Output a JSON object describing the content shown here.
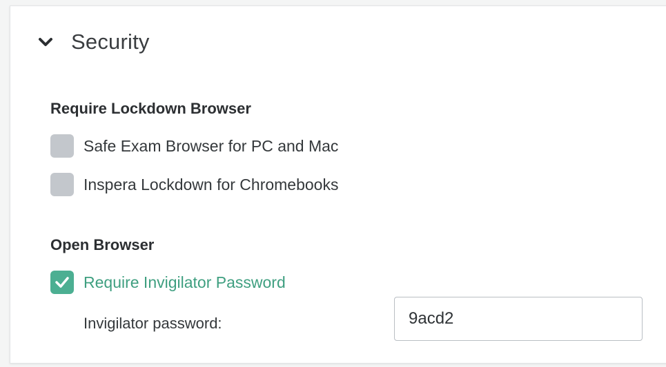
{
  "section": {
    "title": "Security",
    "expanded": true
  },
  "lockdown": {
    "title": "Require Lockdown Browser",
    "options": [
      {
        "label": "Safe Exam Browser for PC and Mac",
        "checked": false
      },
      {
        "label": "Inspera Lockdown for Chromebooks",
        "checked": false
      }
    ]
  },
  "open_browser": {
    "title": "Open Browser",
    "require_password": {
      "label": "Require Invigilator Password",
      "checked": true
    },
    "password_label": "Invigilator password:",
    "password_value": "9acd2"
  },
  "colors": {
    "checkbox_unchecked": "#c3c7cc",
    "checkbox_checked": "#4caf92",
    "active_text": "#3f9f80"
  }
}
